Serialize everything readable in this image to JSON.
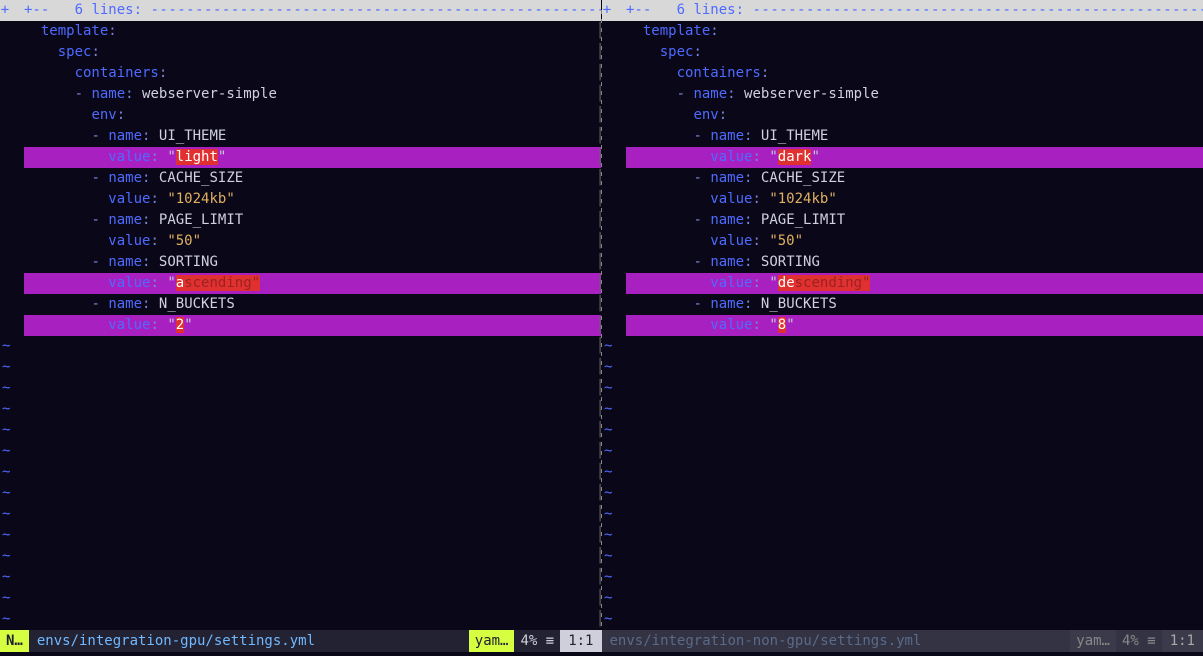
{
  "fold": {
    "gutter": "+",
    "marker": "+--",
    "count": "6 lines:",
    "dashes": "--------------------------------------------------------------------------------------------------"
  },
  "yaml": {
    "template": "template",
    "spec": "spec",
    "containers": "containers",
    "name": "name",
    "env": "env",
    "value": "value",
    "dash": "-",
    "colon": ":"
  },
  "left": {
    "container_name": "webserver-simple",
    "env": [
      {
        "name": "UI_THEME",
        "value_diff": "light",
        "value_q1": "\"",
        "value_q2": "\"",
        "changed": true
      },
      {
        "name": "CACHE_SIZE",
        "value_str": "\"1024kb\"",
        "changed": false
      },
      {
        "name": "PAGE_LIMIT",
        "value_str": "\"50\"",
        "changed": false
      },
      {
        "name": "SORTING",
        "value_diff": "a",
        "value_fade": "scending\"",
        "value_q1": "\"",
        "changed": true
      },
      {
        "name": "N_BUCKETS",
        "value_diff": "2",
        "value_q1": "\"",
        "value_q2": "\"",
        "changed": true
      }
    ],
    "status": {
      "mode": "N…",
      "path": "envs/integration-gpu/settings.yml",
      "filetype": "yam…",
      "percent": "4% ≡",
      "pos": "1:1"
    }
  },
  "right": {
    "container_name": "webserver-simple",
    "env": [
      {
        "name": "UI_THEME",
        "value_diff": "dark",
        "value_q1": "\"",
        "value_q2": "\"",
        "changed": true
      },
      {
        "name": "CACHE_SIZE",
        "value_str": "\"1024kb\"",
        "changed": false
      },
      {
        "name": "PAGE_LIMIT",
        "value_str": "\"50\"",
        "changed": false
      },
      {
        "name": "SORTING",
        "value_diff": "de",
        "value_fade": "scending\"",
        "value_q1": "\"",
        "changed": true
      },
      {
        "name": "N_BUCKETS",
        "value_diff": "8",
        "value_q1": "\"",
        "value_q2": "\"",
        "changed": true
      }
    ],
    "status": {
      "path": "envs/integration-non-gpu/settings.yml",
      "filetype": "yam…",
      "percent": "4% ≡",
      "pos": "1:1"
    }
  },
  "tilde": "~",
  "split_mark": "│"
}
